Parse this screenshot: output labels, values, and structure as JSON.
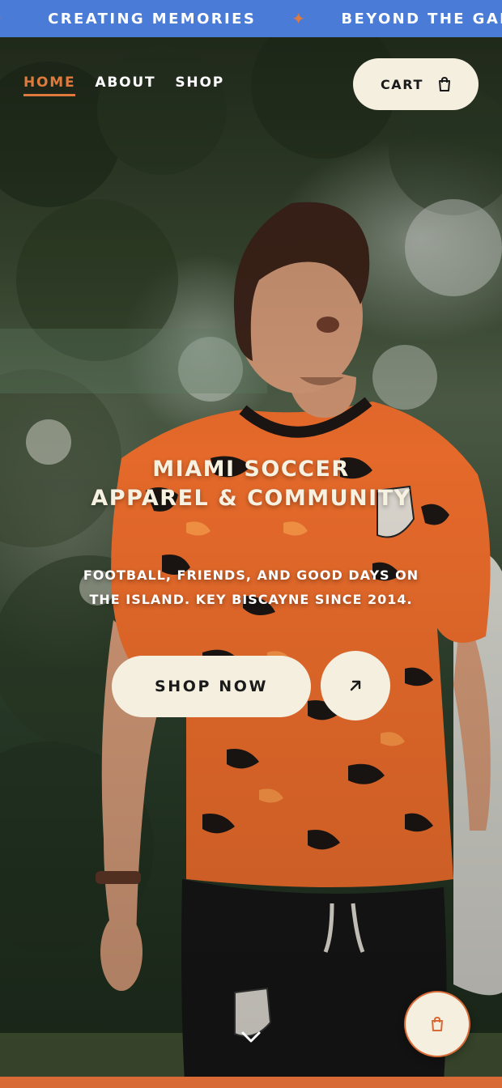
{
  "marquee": {
    "items": [
      "CREATING MEMORIES",
      "BEYOND THE GAME"
    ],
    "separator": "✦"
  },
  "nav": {
    "items": [
      {
        "label": "HOME",
        "active": true
      },
      {
        "label": "ABOUT",
        "active": false
      },
      {
        "label": "SHOP",
        "active": false
      }
    ],
    "cart_label": "CART"
  },
  "hero": {
    "headline_line1": "MIAMI SOCCER",
    "headline_line2": "APPAREL & COMMUNITY",
    "subhead_line1": "FOOTBALL, FRIENDS, AND GOOD DAYS ON",
    "subhead_line2": "THE ISLAND. KEY BISCAYNE SINCE 2014.",
    "cta_label": "SHOP NOW"
  },
  "icons": {
    "cart": "shopping-bag-icon",
    "cta_arrow": "arrow-up-right-icon",
    "scroll": "chevron-down-icon",
    "float_cart": "shopping-bag-icon"
  },
  "colors": {
    "marquee_bg": "#4a7bd6",
    "accent": "#e07a3c",
    "cream": "#f5efe0",
    "bottom_bar": "#d86a35"
  }
}
